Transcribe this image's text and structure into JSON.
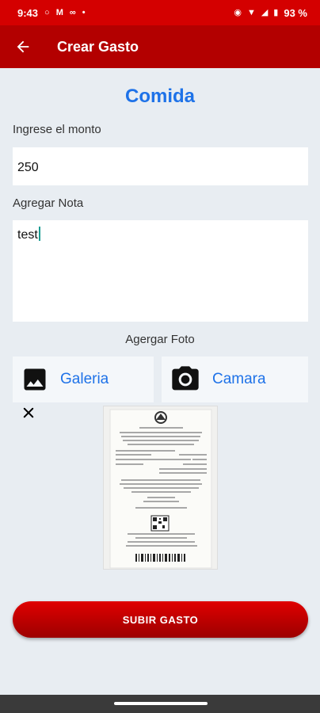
{
  "status_bar": {
    "time": "9:43",
    "battery": "93 %"
  },
  "app_bar": {
    "title": "Crear Gasto"
  },
  "category": "Comida",
  "amount": {
    "label": "Ingrese el monto",
    "value": "250"
  },
  "note": {
    "label": "Agregar Nota",
    "value": "test"
  },
  "photo": {
    "label": "Agergar Foto",
    "gallery_label": "Galeria",
    "camera_label": "Camara"
  },
  "submit_label": "SUBIR GASTO",
  "colors": {
    "primary": "#b30000",
    "status": "#d40000",
    "accent": "#1e72e8",
    "background": "#e8edf2"
  },
  "icons": [
    "back-arrow-icon",
    "image-icon",
    "camera-icon",
    "close-icon"
  ]
}
